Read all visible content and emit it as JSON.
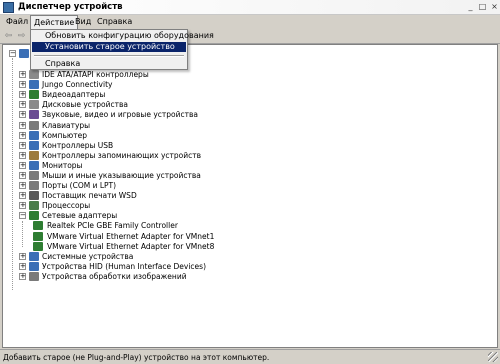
{
  "window": {
    "title": "Диспетчер устройств",
    "controls": {
      "minimize": "_",
      "maximize": "□",
      "close": "×"
    }
  },
  "menu": [
    "Файл",
    "Действие",
    "Вид",
    "Справка"
  ],
  "dropdown": {
    "items": [
      "Обновить конфигурацию оборудования",
      "Установить старое устройство",
      "Справка"
    ],
    "selected_index": 1
  },
  "tree": {
    "categories": [
      {
        "label": "IDE ATA/ATAPI контроллеры",
        "icon": "ide-controller-icon",
        "color": "#8a8a8a"
      },
      {
        "label": "Jungo Connectivity",
        "icon": "usb-device-icon",
        "color": "#3b6fb6"
      },
      {
        "label": "Видеоадаптеры",
        "icon": "display-adapter-icon",
        "color": "#2e7d32"
      },
      {
        "label": "Дисковые устройства",
        "icon": "disk-drive-icon",
        "color": "#8a8a8a"
      },
      {
        "label": "Звуковые, видео и игровые устройства",
        "icon": "sound-icon",
        "color": "#6a4c93"
      },
      {
        "label": "Клавиатуры",
        "icon": "keyboard-icon",
        "color": "#7a7a7a"
      },
      {
        "label": "Компьютер",
        "icon": "computer-icon",
        "color": "#3b6fb6"
      },
      {
        "label": "Контроллеры USB",
        "icon": "usb-controller-icon",
        "color": "#3b6fb6"
      },
      {
        "label": "Контроллеры запоминающих устройств",
        "icon": "storage-controller-icon",
        "color": "#9c7a3c"
      },
      {
        "label": "Мониторы",
        "icon": "monitor-icon",
        "color": "#3b6fb6"
      },
      {
        "label": "Мыши и иные указывающие устройства",
        "icon": "mouse-icon",
        "color": "#7a7a7a"
      },
      {
        "label": "Порты (COM и LPT)",
        "icon": "port-icon",
        "color": "#7a7a7a"
      },
      {
        "label": "Поставщик печати WSD",
        "icon": "printer-icon",
        "color": "#5a5a5a"
      },
      {
        "label": "Процессоры",
        "icon": "processor-icon",
        "color": "#4a7d4a"
      },
      {
        "label": "Сетевые адаптеры",
        "icon": "network-adapter-icon",
        "color": "#2e7d32",
        "expanded": true
      },
      {
        "label": "Системные устройства",
        "icon": "system-device-icon",
        "color": "#3b6fb6"
      },
      {
        "label": "Устройства HID (Human Interface Devices)",
        "icon": "hid-icon",
        "color": "#3b6fb6"
      },
      {
        "label": "Устройства обработки изображений",
        "icon": "imaging-device-icon",
        "color": "#7a7a7a"
      }
    ],
    "network_children": [
      "Realtek PCIe GBE Family Controller",
      "VMware Virtual Ethernet Adapter for VMnet1",
      "VMware Virtual Ethernet Adapter for VMnet8"
    ]
  },
  "status": "Добавить старое (не Plug-and-Play) устройство на этот компьютер.",
  "colors": {
    "menu_highlight": "#0a246a",
    "window_bg": "#d4d0c8"
  }
}
